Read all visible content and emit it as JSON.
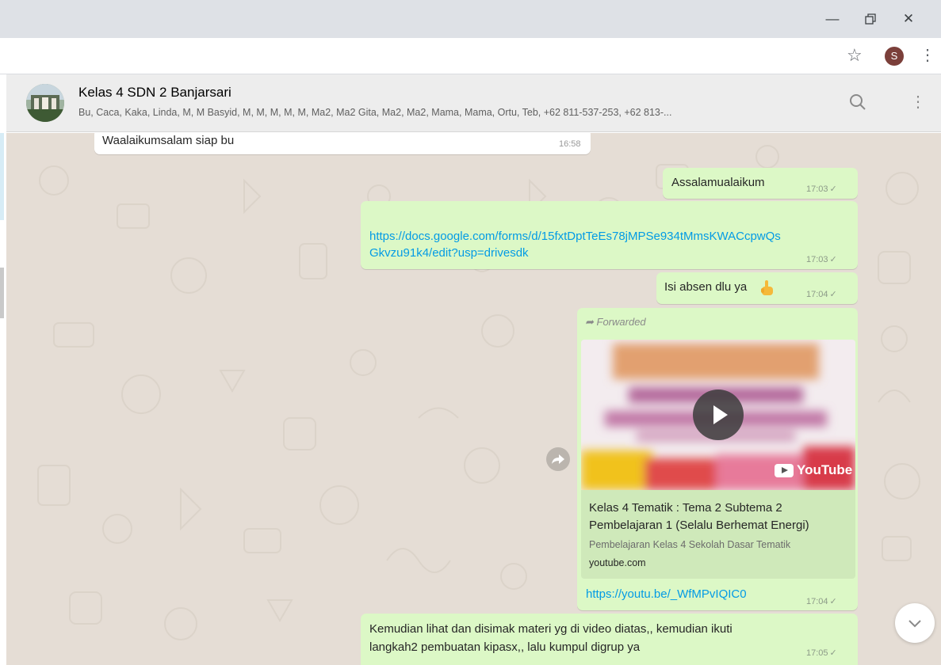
{
  "browser": {
    "profile_initial": "S"
  },
  "chat_header": {
    "group_name": "Kelas 4 SDN 2 Banjarsari",
    "members": "Bu, Caca, Kaka, Linda, M, M Basyid, M, M, M, M, M, Ma2, Ma2 Gita, Ma2, Ma2, Mama, Mama, Ortu, Teb, +62 811-537-253, +62 813-..."
  },
  "messages": {
    "m1": {
      "text": "Waalaikumsalam siap bu",
      "time": "16:58"
    },
    "m2": {
      "text": "Assalamualaikum",
      "time": "17:03"
    },
    "m3": {
      "line1": "https://docs.google.com/forms/d/15fxtDptTeEs78jMPSe934tMmsKWACcpwQs",
      "line2": "Gkvzu91k4/edit?usp=drivesdk",
      "time": "17:03"
    },
    "m4": {
      "text": "Isi absen dlu ya",
      "time": "17:04"
    },
    "m5": {
      "forwarded_label": "Forwarded",
      "youtube_label": "YouTube",
      "preview_title": "Kelas 4 Tematik : Tema 2 Subtema 2 Pembelajaran 1 (Selalu Berhemat Energi)",
      "preview_description": "Pembelajaran Kelas 4 Sekolah Dasar Tematik",
      "preview_domain": "youtube.com",
      "link": "https://youtu.be/_WfMPvIQIC0",
      "time": "17:04"
    },
    "m6": {
      "line1": "Kemudian lihat dan disimak materi yg di video diatas,, kemudian ikuti",
      "line2": "langkah2 pembuatan kipasx,, lalu kumpul digrup ya",
      "time": "17:05"
    }
  },
  "colors": {
    "chat_background": "#e5ddd5",
    "outgoing_bubble": "#dcf8c6",
    "incoming_bubble": "#ffffff",
    "link": "#039be5"
  },
  "icons": [
    "minimize-icon",
    "maximize-icon",
    "close-icon",
    "star-icon",
    "kebab-menu-icon",
    "search-icon",
    "forward-icon",
    "play-icon",
    "chevron-down-icon",
    "check-icon",
    "pointing-hand-emoji"
  ]
}
